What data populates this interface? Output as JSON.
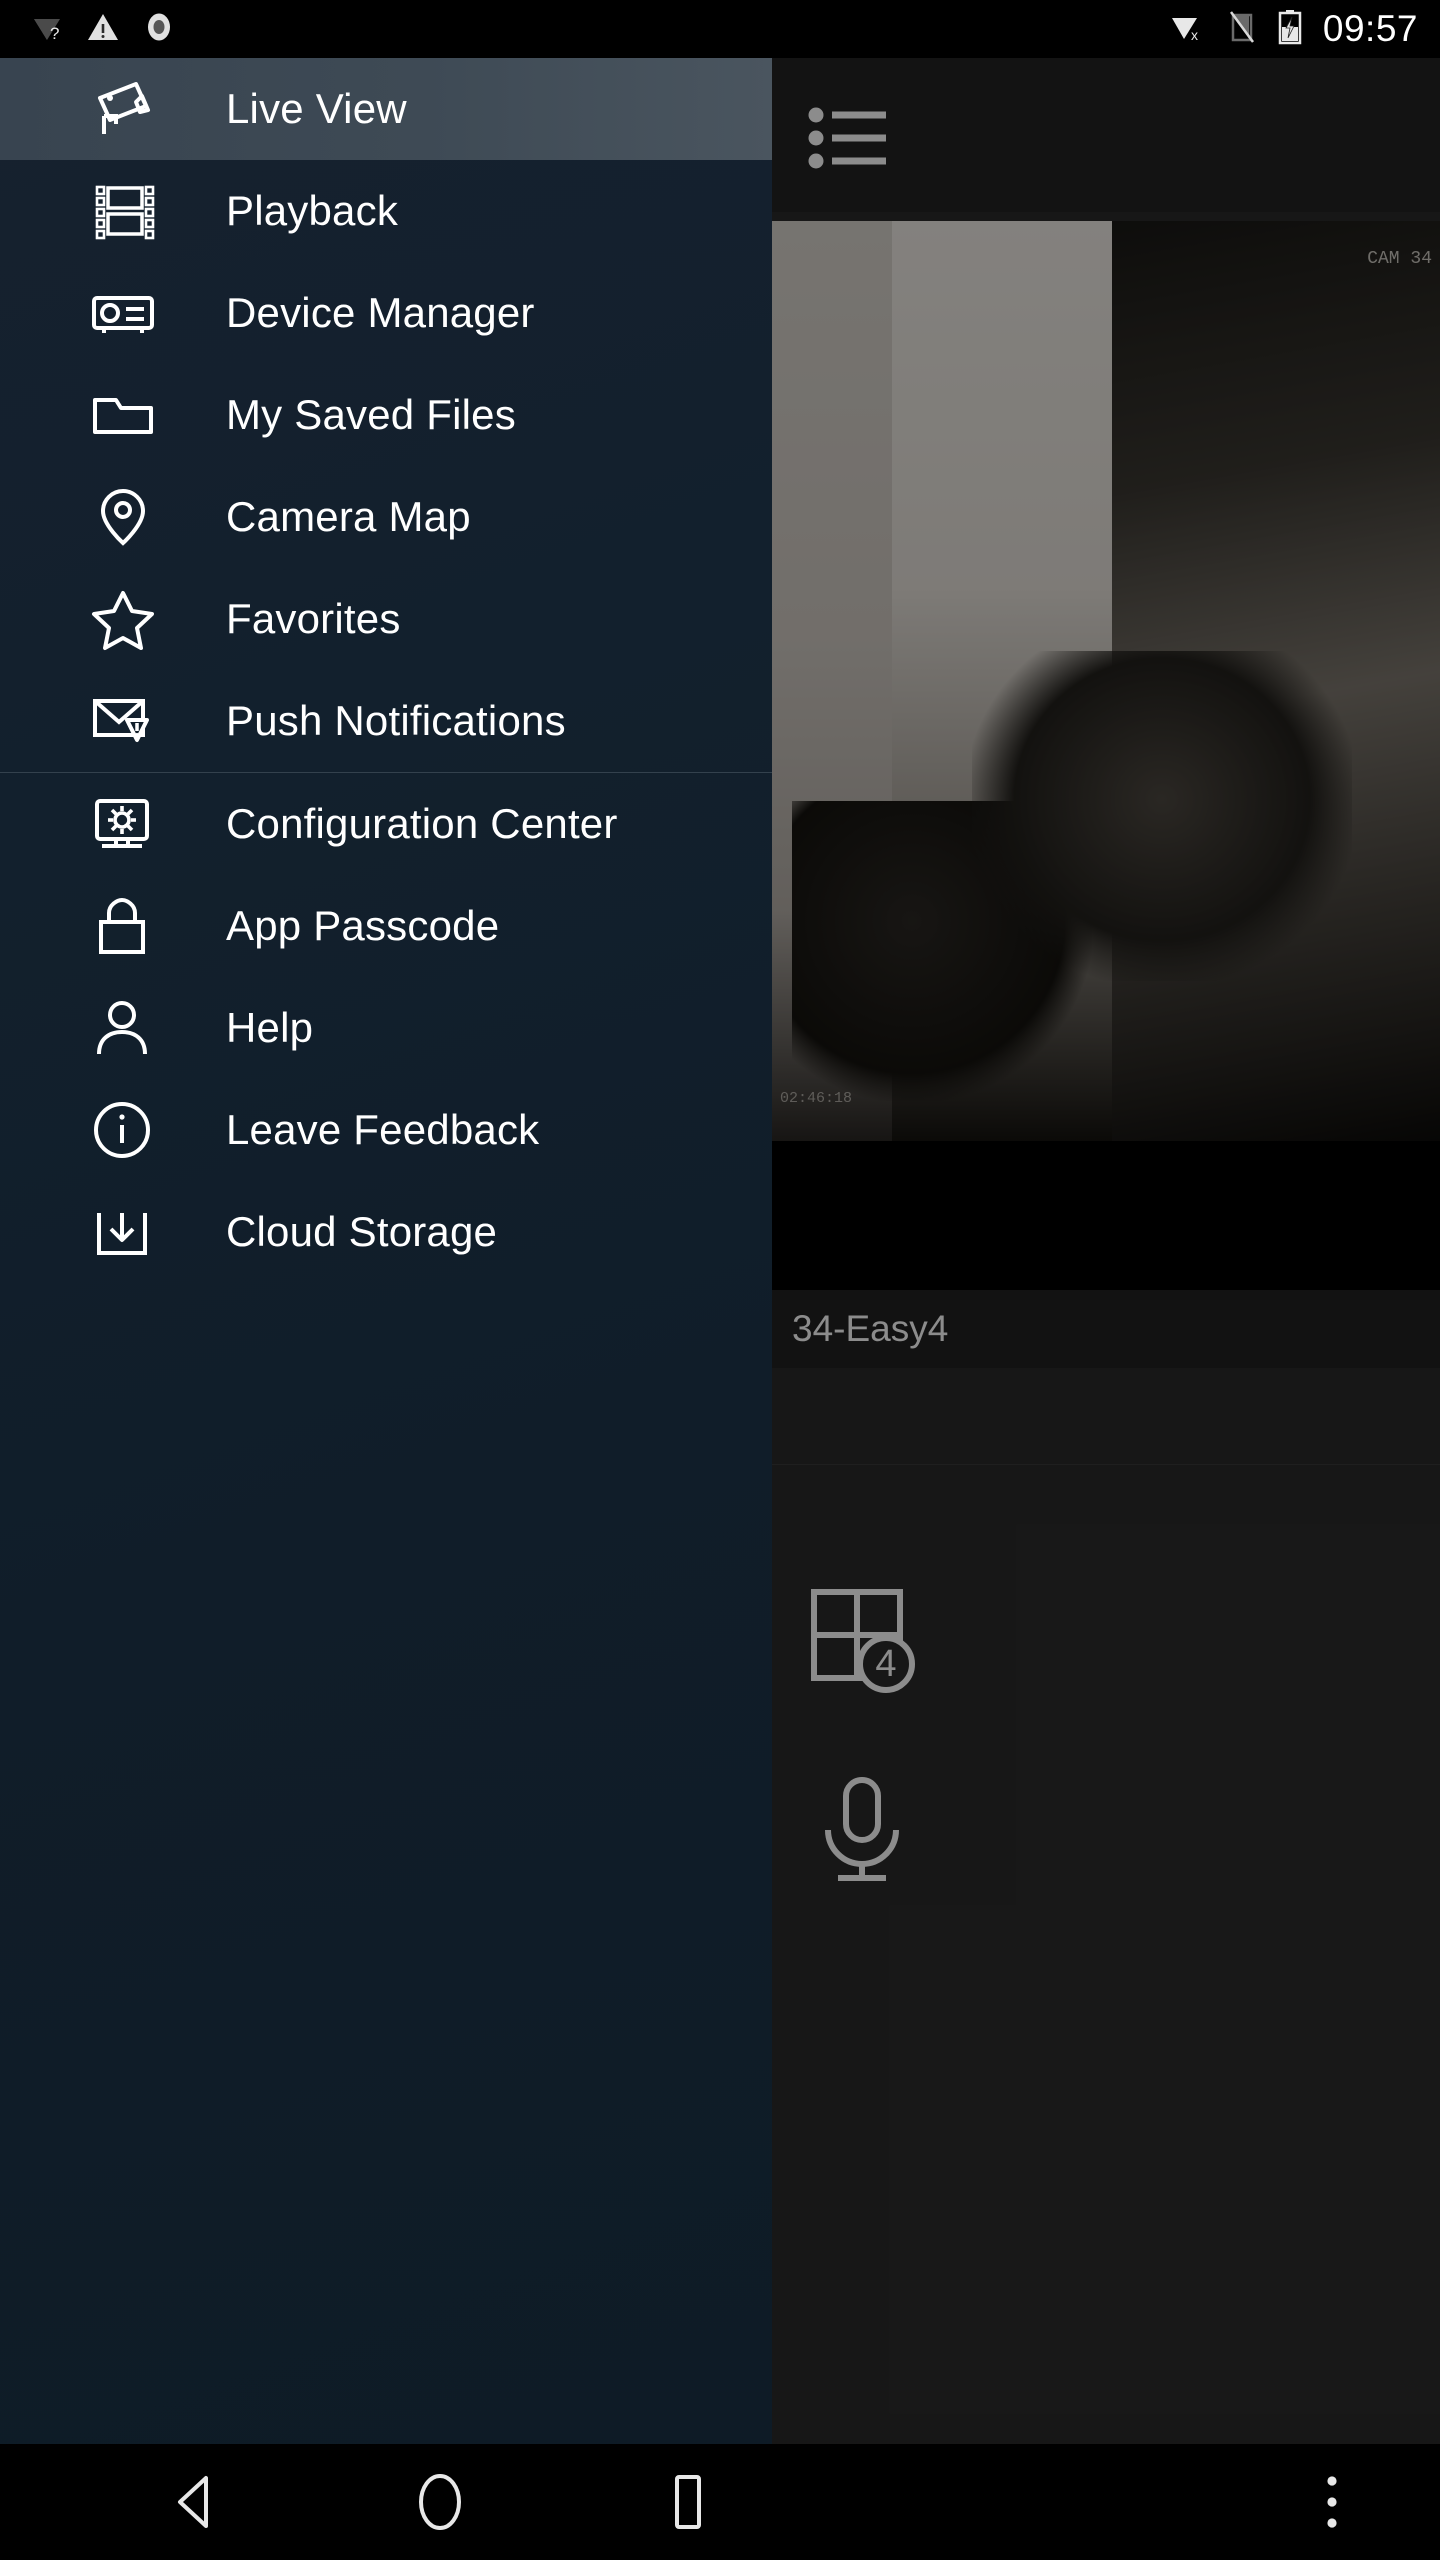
{
  "status_bar": {
    "time": "09:57",
    "left_icons": [
      "wifi-unknown-icon",
      "warning-triangle-icon",
      "record-circle-icon"
    ],
    "right_icons": [
      "wifi-disconnected-icon",
      "no-sim-icon",
      "battery-charging-icon"
    ]
  },
  "drawer": {
    "items": [
      {
        "label": "Live View",
        "icon": "cctv-camera-icon",
        "selected": true
      },
      {
        "label": "Playback",
        "icon": "film-strip-icon",
        "selected": false
      },
      {
        "label": "Device Manager",
        "icon": "dvr-device-icon",
        "selected": false
      },
      {
        "label": "My Saved Files",
        "icon": "folder-icon",
        "selected": false
      },
      {
        "label": "Camera Map",
        "icon": "map-pin-icon",
        "selected": false
      },
      {
        "label": "Favorites",
        "icon": "star-icon",
        "selected": false
      },
      {
        "label": "Push Notifications",
        "icon": "envelope-alert-icon",
        "selected": false
      },
      {
        "label": "Configuration Center",
        "icon": "monitor-gear-icon",
        "selected": false
      },
      {
        "label": "App Passcode",
        "icon": "padlock-icon",
        "selected": false
      },
      {
        "label": "Help",
        "icon": "person-icon",
        "selected": false
      },
      {
        "label": "Leave Feedback",
        "icon": "info-circle-icon",
        "selected": false
      },
      {
        "label": "Cloud Storage",
        "icon": "cloud-download-icon",
        "selected": false
      }
    ],
    "divider_after_index": 6
  },
  "live_view_panel": {
    "list_button_icon": "bulleted-list-icon",
    "camera_label": "34-Easy4",
    "video_timestamp": "02:46:18",
    "video_overlay_text": "CAM 34",
    "split_view_button": {
      "icon": "grid-4-view-icon",
      "badge": "4"
    },
    "mic_button": {
      "icon": "microphone-icon"
    }
  },
  "nav_bar": {
    "back": "back-triangle-icon",
    "home": "home-circle-icon",
    "recents": "recents-square-icon",
    "more": "overflow-menu-icon"
  },
  "colors": {
    "drawer_bg": "#101d29",
    "selected_item_bg": "#424d58",
    "panel_bg": "#2b2b2b",
    "text": "#ffffff",
    "divider": "#33414d"
  }
}
